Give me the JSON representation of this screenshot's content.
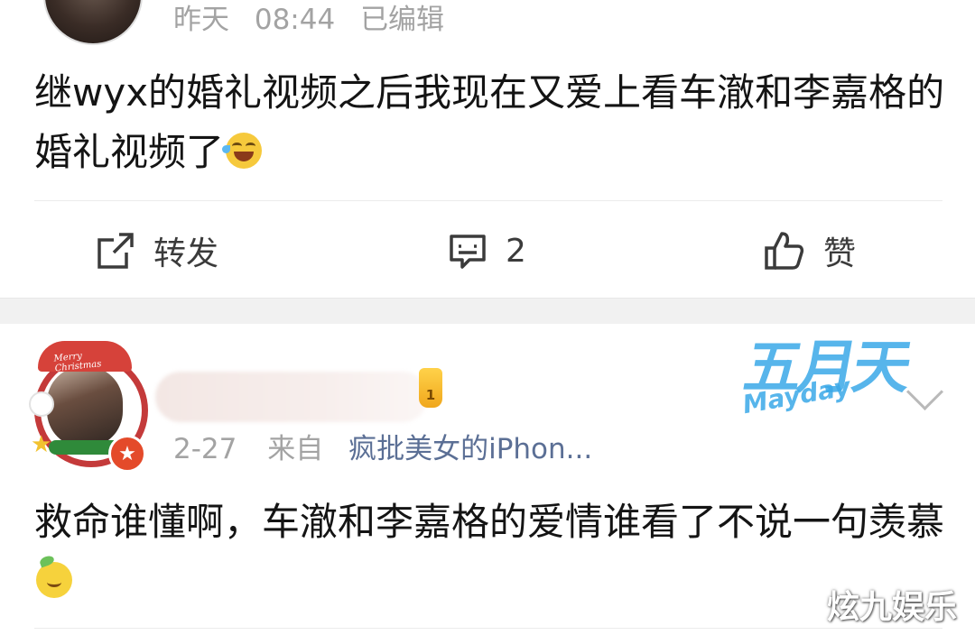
{
  "post1": {
    "meta": {
      "day": "昨天",
      "time": "08:44",
      "edited": "已编辑"
    },
    "content": "继wyx的婚礼视频之后我现在又爱上看车澈和李嘉格的婚礼视频了",
    "emoji": "laugh-crying-icon",
    "actions": {
      "repost_label": "转发",
      "comment_count": "2",
      "like_label": "赞"
    }
  },
  "post2": {
    "avatar_hat_text": "Merry Christmas",
    "sticker": {
      "cn": "五月天",
      "en": "Mayday"
    },
    "meta": {
      "date": "2-27",
      "from": "来自",
      "device": "疯批美女的iPhon..."
    },
    "content": "救命谁懂啊，车澈和李嘉格的爱情谁看了不说一句羡慕",
    "emoji": "shy-smile-icon"
  },
  "watermark": "炫九娱乐",
  "colors": {
    "meta_gray": "#a3a3a3",
    "device_link": "#5b6f95",
    "text": "#141414",
    "sticker_blue": "#3aa9e8"
  }
}
